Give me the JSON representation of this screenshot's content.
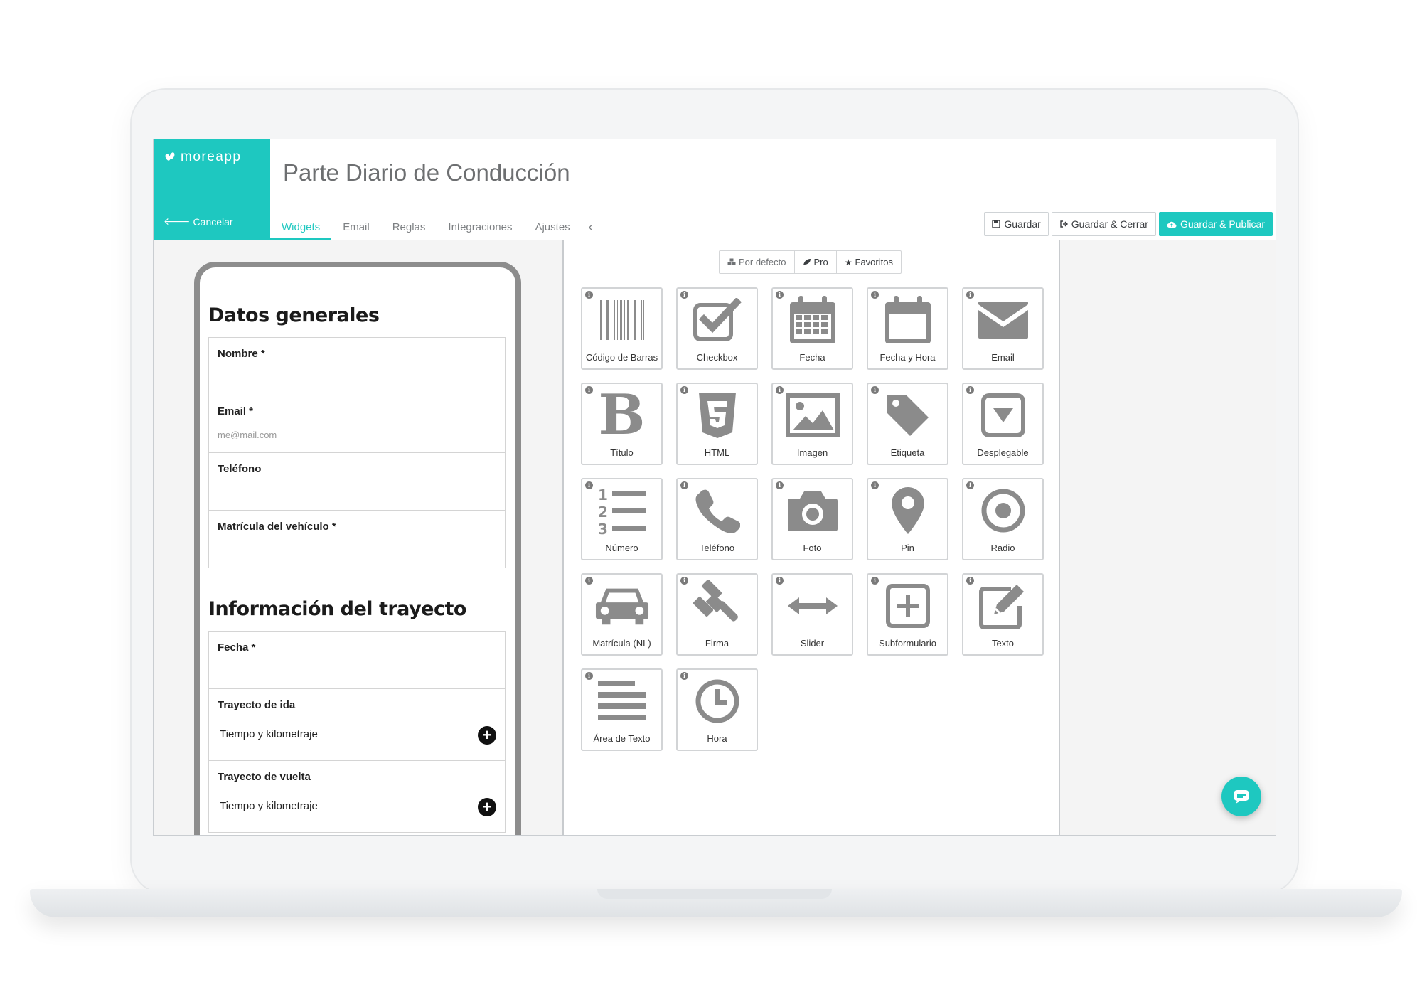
{
  "brand": {
    "name": "moreapp",
    "cancel_label": "Cancelar"
  },
  "header": {
    "title": "Parte Diario de Conducción"
  },
  "tabs": [
    {
      "label": "Widgets",
      "active": true
    },
    {
      "label": "Email"
    },
    {
      "label": "Reglas"
    },
    {
      "label": "Integraciones"
    },
    {
      "label": "Ajustes"
    }
  ],
  "actions": {
    "save": "Guardar",
    "save_close": "Guardar & Cerrar",
    "save_publish": "Guardar & Publicar"
  },
  "accent_color": "#1ec8c0",
  "form": {
    "section1_title": "Datos generales",
    "fields1": [
      {
        "label": "Nombre *",
        "placeholder": ""
      },
      {
        "label": "Email *",
        "placeholder": "me@mail.com"
      },
      {
        "label": "Teléfono",
        "placeholder": ""
      },
      {
        "label": "Matrícula del vehículo *",
        "placeholder": ""
      }
    ],
    "section2_title": "Información del trayecto",
    "fecha_label": "Fecha *",
    "trip_out": {
      "label": "Trayecto de ida",
      "sub": "Tiempo y kilometraje"
    },
    "trip_back": {
      "label": "Trayecto de vuelta",
      "sub": "Tiempo y kilometraje"
    }
  },
  "filters": {
    "default": "Por defecto",
    "pro": "Pro",
    "favorites": "Favoritos"
  },
  "widgets": [
    {
      "label": "Código de Barras",
      "icon": "barcode-icon"
    },
    {
      "label": "Checkbox",
      "icon": "checkbox-icon"
    },
    {
      "label": "Fecha",
      "icon": "calendar-icon"
    },
    {
      "label": "Fecha y Hora",
      "icon": "calendar-empty-icon"
    },
    {
      "label": "Email",
      "icon": "envelope-icon"
    },
    {
      "label": "Título",
      "icon": "bold-icon"
    },
    {
      "label": "HTML",
      "icon": "html5-icon"
    },
    {
      "label": "Imagen",
      "icon": "image-icon"
    },
    {
      "label": "Etiqueta",
      "icon": "tag-icon"
    },
    {
      "label": "Desplegable",
      "icon": "dropdown-icon"
    },
    {
      "label": "Número",
      "icon": "numbered-list-icon"
    },
    {
      "label": "Teléfono",
      "icon": "phone-icon"
    },
    {
      "label": "Foto",
      "icon": "camera-icon"
    },
    {
      "label": "Pin",
      "icon": "map-pin-icon"
    },
    {
      "label": "Radio",
      "icon": "radio-icon"
    },
    {
      "label": "Matrícula (NL)",
      "icon": "car-icon"
    },
    {
      "label": "Firma",
      "icon": "gavel-icon"
    },
    {
      "label": "Slider",
      "icon": "arrows-horizontal-icon"
    },
    {
      "label": "Subformulario",
      "icon": "plus-square-icon"
    },
    {
      "label": "Texto",
      "icon": "edit-icon"
    },
    {
      "label": "Área de Texto",
      "icon": "align-justify-icon"
    },
    {
      "label": "Hora",
      "icon": "clock-icon"
    }
  ]
}
